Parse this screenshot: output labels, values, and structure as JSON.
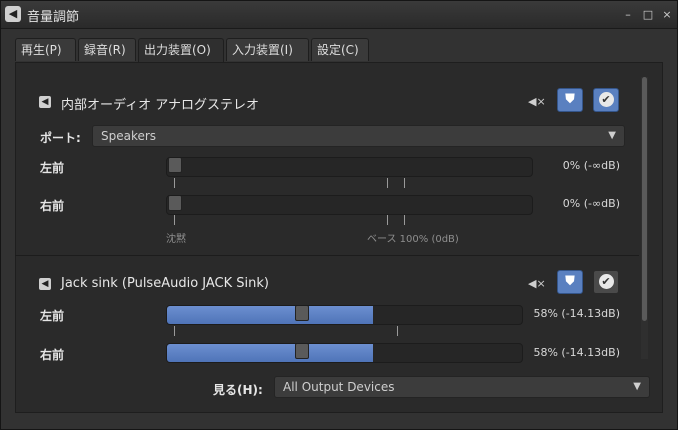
{
  "window": {
    "title": "音量調節",
    "buttons": [
      "–",
      "□",
      "×"
    ]
  },
  "tabs": [
    {
      "label": "再生(P)"
    },
    {
      "label": "録音(R)"
    },
    {
      "label": "出力装置(O)",
      "active": true
    },
    {
      "label": "入力装置(I)"
    },
    {
      "label": "設定(C)"
    }
  ],
  "devices": [
    {
      "name": "内部オーディオ アナログステレオ",
      "port_label": "ポート:",
      "port_value": "Speakers",
      "default_selected": true,
      "channels": [
        {
          "label": "左前",
          "percent": 0,
          "value_text": "0% (-∞dB)"
        },
        {
          "label": "右前",
          "percent": 0,
          "value_text": "0% (-∞dB)"
        }
      ],
      "marks": {
        "silence": "沈黙",
        "base": "ベース 100% (0dB)"
      }
    },
    {
      "name": "Jack sink (PulseAudio JACK Sink)",
      "default_selected": false,
      "channels": [
        {
          "label": "左前",
          "percent": 58,
          "value_text": "58% (-14.13dB)"
        },
        {
          "label": "右前",
          "percent": 58,
          "value_text": "58% (-14.13dB)"
        }
      ]
    }
  ],
  "footer": {
    "show_label": "見る(H):",
    "show_value": "All Output Devices"
  },
  "colors": {
    "accent": "#5a80c0",
    "fill": "#5b7fc2"
  }
}
